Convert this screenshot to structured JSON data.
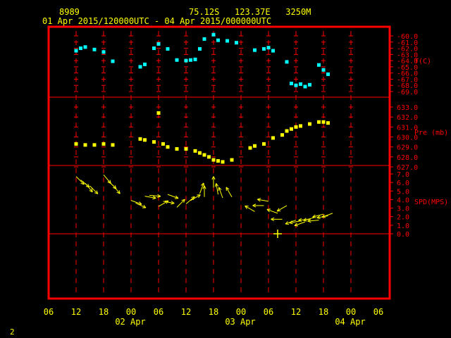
{
  "header": {
    "station_id": "8989",
    "location": "75.12S   123.37E   3250M",
    "time_range": "01 Apr 2015/120000UTC - 04 Apr 2015/000000UTC"
  },
  "footer": {
    "page_number": "2"
  },
  "colors": {
    "frame": "#ff0000",
    "axis_labels": "#ffff00",
    "temperature": "#00ffff",
    "pressure": "#ffff00",
    "wind": "#ffff00"
  },
  "chart_data": {
    "type": "multi-panel time series",
    "x_axis": {
      "tick_labels": [
        "06",
        "12",
        "18",
        "00",
        "06",
        "12",
        "18",
        "00",
        "06",
        "12",
        "18",
        "00",
        "06"
      ],
      "date_labels": [
        "02 Apr",
        "03 Apr",
        "04 Apr"
      ],
      "grid": "dashed vertical lines every 6 hours"
    },
    "panels": [
      {
        "name": "temperature",
        "label": "T(C)",
        "type": "scatter",
        "tick_labels": [
          "-60.0",
          "-61.0",
          "-62.0",
          "-63.0",
          "-64.0",
          "-65.0",
          "-66.0",
          "-67.0",
          "-68.0",
          "-69.0"
        ],
        "ylim": [
          -69.0,
          -60.0
        ],
        "points": [
          {
            "t": "2015-04-01 12:00",
            "v": -62.4
          },
          {
            "t": "2015-04-01 13:00",
            "v": -62.0
          },
          {
            "t": "2015-04-01 14:00",
            "v": -61.8
          },
          {
            "t": "2015-04-01 16:00",
            "v": -62.2
          },
          {
            "t": "2015-04-01 18:00",
            "v": -62.6
          },
          {
            "t": "2015-04-01 20:00",
            "v": -64.1
          },
          {
            "t": "2015-04-02 02:00",
            "v": -65.0
          },
          {
            "t": "2015-04-02 03:00",
            "v": -64.6
          },
          {
            "t": "2015-04-02 05:00",
            "v": -62.0
          },
          {
            "t": "2015-04-02 06:00",
            "v": -61.3
          },
          {
            "t": "2015-04-02 08:00",
            "v": -62.1
          },
          {
            "t": "2015-04-02 10:00",
            "v": -63.9
          },
          {
            "t": "2015-04-02 12:00",
            "v": -64.0
          },
          {
            "t": "2015-04-02 13:00",
            "v": -63.9
          },
          {
            "t": "2015-04-02 14:00",
            "v": -63.8
          },
          {
            "t": "2015-04-02 15:00",
            "v": -62.1
          },
          {
            "t": "2015-04-02 16:00",
            "v": -60.5
          },
          {
            "t": "2015-04-02 18:00",
            "v": -59.8
          },
          {
            "t": "2015-04-02 19:00",
            "v": -60.7
          },
          {
            "t": "2015-04-02 21:00",
            "v": -60.8
          },
          {
            "t": "2015-04-02 23:00",
            "v": -61.1
          },
          {
            "t": "2015-04-03 03:00",
            "v": -62.3
          },
          {
            "t": "2015-04-03 05:00",
            "v": -62.1
          },
          {
            "t": "2015-04-03 06:00",
            "v": -61.9
          },
          {
            "t": "2015-04-03 07:00",
            "v": -62.4
          },
          {
            "t": "2015-04-03 10:00",
            "v": -64.2
          },
          {
            "t": "2015-04-03 11:00",
            "v": -67.7
          },
          {
            "t": "2015-04-03 12:00",
            "v": -68.0
          },
          {
            "t": "2015-04-03 13:00",
            "v": -67.8
          },
          {
            "t": "2015-04-03 14:00",
            "v": -68.2
          },
          {
            "t": "2015-04-03 15:00",
            "v": -67.9
          },
          {
            "t": "2015-04-03 17:00",
            "v": -64.7
          },
          {
            "t": "2015-04-03 18:00",
            "v": -65.5
          },
          {
            "t": "2015-04-03 19:00",
            "v": -66.2
          }
        ]
      },
      {
        "name": "pressure",
        "label": "Pre (mb)",
        "type": "scatter",
        "tick_labels": [
          "633.0",
          "632.0",
          "631.0",
          "630.0",
          "629.0",
          "628.0",
          "627.0"
        ],
        "ylim": [
          627.0,
          633.0
        ],
        "points": [
          {
            "t": "2015-04-01 12:00",
            "v": 629.3
          },
          {
            "t": "2015-04-01 14:00",
            "v": 629.2
          },
          {
            "t": "2015-04-01 16:00",
            "v": 629.2
          },
          {
            "t": "2015-04-01 18:00",
            "v": 629.3
          },
          {
            "t": "2015-04-01 20:00",
            "v": 629.2
          },
          {
            "t": "2015-04-02 02:00",
            "v": 629.8
          },
          {
            "t": "2015-04-02 03:00",
            "v": 629.7
          },
          {
            "t": "2015-04-02 05:00",
            "v": 629.5
          },
          {
            "t": "2015-04-02 06:00",
            "v": 632.4
          },
          {
            "t": "2015-04-02 07:00",
            "v": 629.3
          },
          {
            "t": "2015-04-02 08:00",
            "v": 629.0
          },
          {
            "t": "2015-04-02 10:00",
            "v": 628.8
          },
          {
            "t": "2015-04-02 12:00",
            "v": 628.8
          },
          {
            "t": "2015-04-02 14:00",
            "v": 628.6
          },
          {
            "t": "2015-04-02 15:00",
            "v": 628.4
          },
          {
            "t": "2015-04-02 16:00",
            "v": 628.2
          },
          {
            "t": "2015-04-02 17:00",
            "v": 628.0
          },
          {
            "t": "2015-04-02 18:00",
            "v": 627.7
          },
          {
            "t": "2015-04-02 19:00",
            "v": 627.6
          },
          {
            "t": "2015-04-02 20:00",
            "v": 627.5
          },
          {
            "t": "2015-04-02 22:00",
            "v": 627.7
          },
          {
            "t": "2015-04-03 02:00",
            "v": 628.9
          },
          {
            "t": "2015-04-03 03:00",
            "v": 629.1
          },
          {
            "t": "2015-04-03 05:00",
            "v": 629.3
          },
          {
            "t": "2015-04-03 07:00",
            "v": 629.9
          },
          {
            "t": "2015-04-03 09:00",
            "v": 630.2
          },
          {
            "t": "2015-04-03 10:00",
            "v": 630.6
          },
          {
            "t": "2015-04-03 11:00",
            "v": 630.8
          },
          {
            "t": "2015-04-03 12:00",
            "v": 631.0
          },
          {
            "t": "2015-04-03 13:00",
            "v": 631.1
          },
          {
            "t": "2015-04-03 15:00",
            "v": 631.3
          },
          {
            "t": "2015-04-03 17:00",
            "v": 631.5
          },
          {
            "t": "2015-04-03 18:00",
            "v": 631.5
          },
          {
            "t": "2015-04-03 19:00",
            "v": 631.4
          }
        ]
      },
      {
        "name": "wind",
        "label": "SPD(MPS)",
        "type": "wind arrows",
        "tick_labels": [
          "7.0",
          "6.0",
          "5.0",
          "4.0",
          "3.0",
          "2.0",
          "1.0",
          "0.0"
        ],
        "ylim": [
          0.0,
          7.0
        ],
        "points": [
          {
            "t": "2015-04-01 12:00",
            "spd": 6.7,
            "dir_deg": 135
          },
          {
            "t": "2015-04-01 13:00",
            "spd": 6.3,
            "dir_deg": 130
          },
          {
            "t": "2015-04-01 14:00",
            "spd": 5.9,
            "dir_deg": 140
          },
          {
            "t": "2015-04-01 15:00",
            "spd": 5.6,
            "dir_deg": 135
          },
          {
            "t": "2015-04-01 18:00",
            "spd": 6.9,
            "dir_deg": 140
          },
          {
            "t": "2015-04-01 19:00",
            "spd": 6.2,
            "dir_deg": 135
          },
          {
            "t": "2015-04-01 20:00",
            "spd": 5.7,
            "dir_deg": 140
          },
          {
            "t": "2015-04-02 00:00",
            "spd": 3.9,
            "dir_deg": 110
          },
          {
            "t": "2015-04-02 01:00",
            "spd": 3.6,
            "dir_deg": 115
          },
          {
            "t": "2015-04-02 03:00",
            "spd": 4.4,
            "dir_deg": 100
          },
          {
            "t": "2015-04-02 04:00",
            "spd": 4.5,
            "dir_deg": 95
          },
          {
            "t": "2015-04-02 06:00",
            "spd": 3.2,
            "dir_deg": 60
          },
          {
            "t": "2015-04-02 07:00",
            "spd": 3.8,
            "dir_deg": 100
          },
          {
            "t": "2015-04-02 08:00",
            "spd": 4.6,
            "dir_deg": 110
          },
          {
            "t": "2015-04-02 10:00",
            "spd": 3.1,
            "dir_deg": 45
          },
          {
            "t": "2015-04-02 12:00",
            "spd": 3.5,
            "dir_deg": 50
          },
          {
            "t": "2015-04-02 13:00",
            "spd": 3.9,
            "dir_deg": 60
          },
          {
            "t": "2015-04-02 15:00",
            "spd": 4.7,
            "dir_deg": 20
          },
          {
            "t": "2015-04-02 16:00",
            "spd": 4.3,
            "dir_deg": 0
          },
          {
            "t": "2015-04-02 18:00",
            "spd": 5.4,
            "dir_deg": 0
          },
          {
            "t": "2015-04-02 19:00",
            "spd": 4.6,
            "dir_deg": 350
          },
          {
            "t": "2015-04-02 20:00",
            "spd": 4.2,
            "dir_deg": 340
          },
          {
            "t": "2015-04-02 22:00",
            "spd": 4.3,
            "dir_deg": 330
          },
          {
            "t": "2015-04-03 03:00",
            "spd": 2.6,
            "dir_deg": 300
          },
          {
            "t": "2015-04-03 05:00",
            "spd": 3.3,
            "dir_deg": 270
          },
          {
            "t": "2015-04-03 06:00",
            "spd": 3.8,
            "dir_deg": 280
          },
          {
            "t": "2015-04-03 08:00",
            "spd": 2.4,
            "dir_deg": 290
          },
          {
            "t": "2015-04-03 09:00",
            "spd": 1.7,
            "dir_deg": 270
          },
          {
            "t": "2015-04-03 10:00",
            "spd": 3.3,
            "dir_deg": 240
          },
          {
            "t": "2015-04-03 12:00",
            "spd": 1.6,
            "dir_deg": 250
          },
          {
            "t": "2015-04-03 13:00",
            "spd": 1.5,
            "dir_deg": 260
          },
          {
            "t": "2015-04-03 14:00",
            "spd": 1.4,
            "dir_deg": 250
          },
          {
            "t": "2015-04-03 15:00",
            "spd": 1.7,
            "dir_deg": 265
          },
          {
            "t": "2015-04-03 16:00",
            "spd": 1.9,
            "dir_deg": 255
          },
          {
            "t": "2015-04-03 17:00",
            "spd": 1.6,
            "dir_deg": 265
          },
          {
            "t": "2015-04-03 18:00",
            "spd": 2.3,
            "dir_deg": 255
          },
          {
            "t": "2015-04-03 19:00",
            "spd": 2.1,
            "dir_deg": 260
          },
          {
            "t": "2015-04-03 20:00",
            "spd": 2.4,
            "dir_deg": 250
          }
        ],
        "calm_points": [
          {
            "t": "2015-04-03 08:00",
            "spd": 0.0
          }
        ]
      }
    ]
  }
}
